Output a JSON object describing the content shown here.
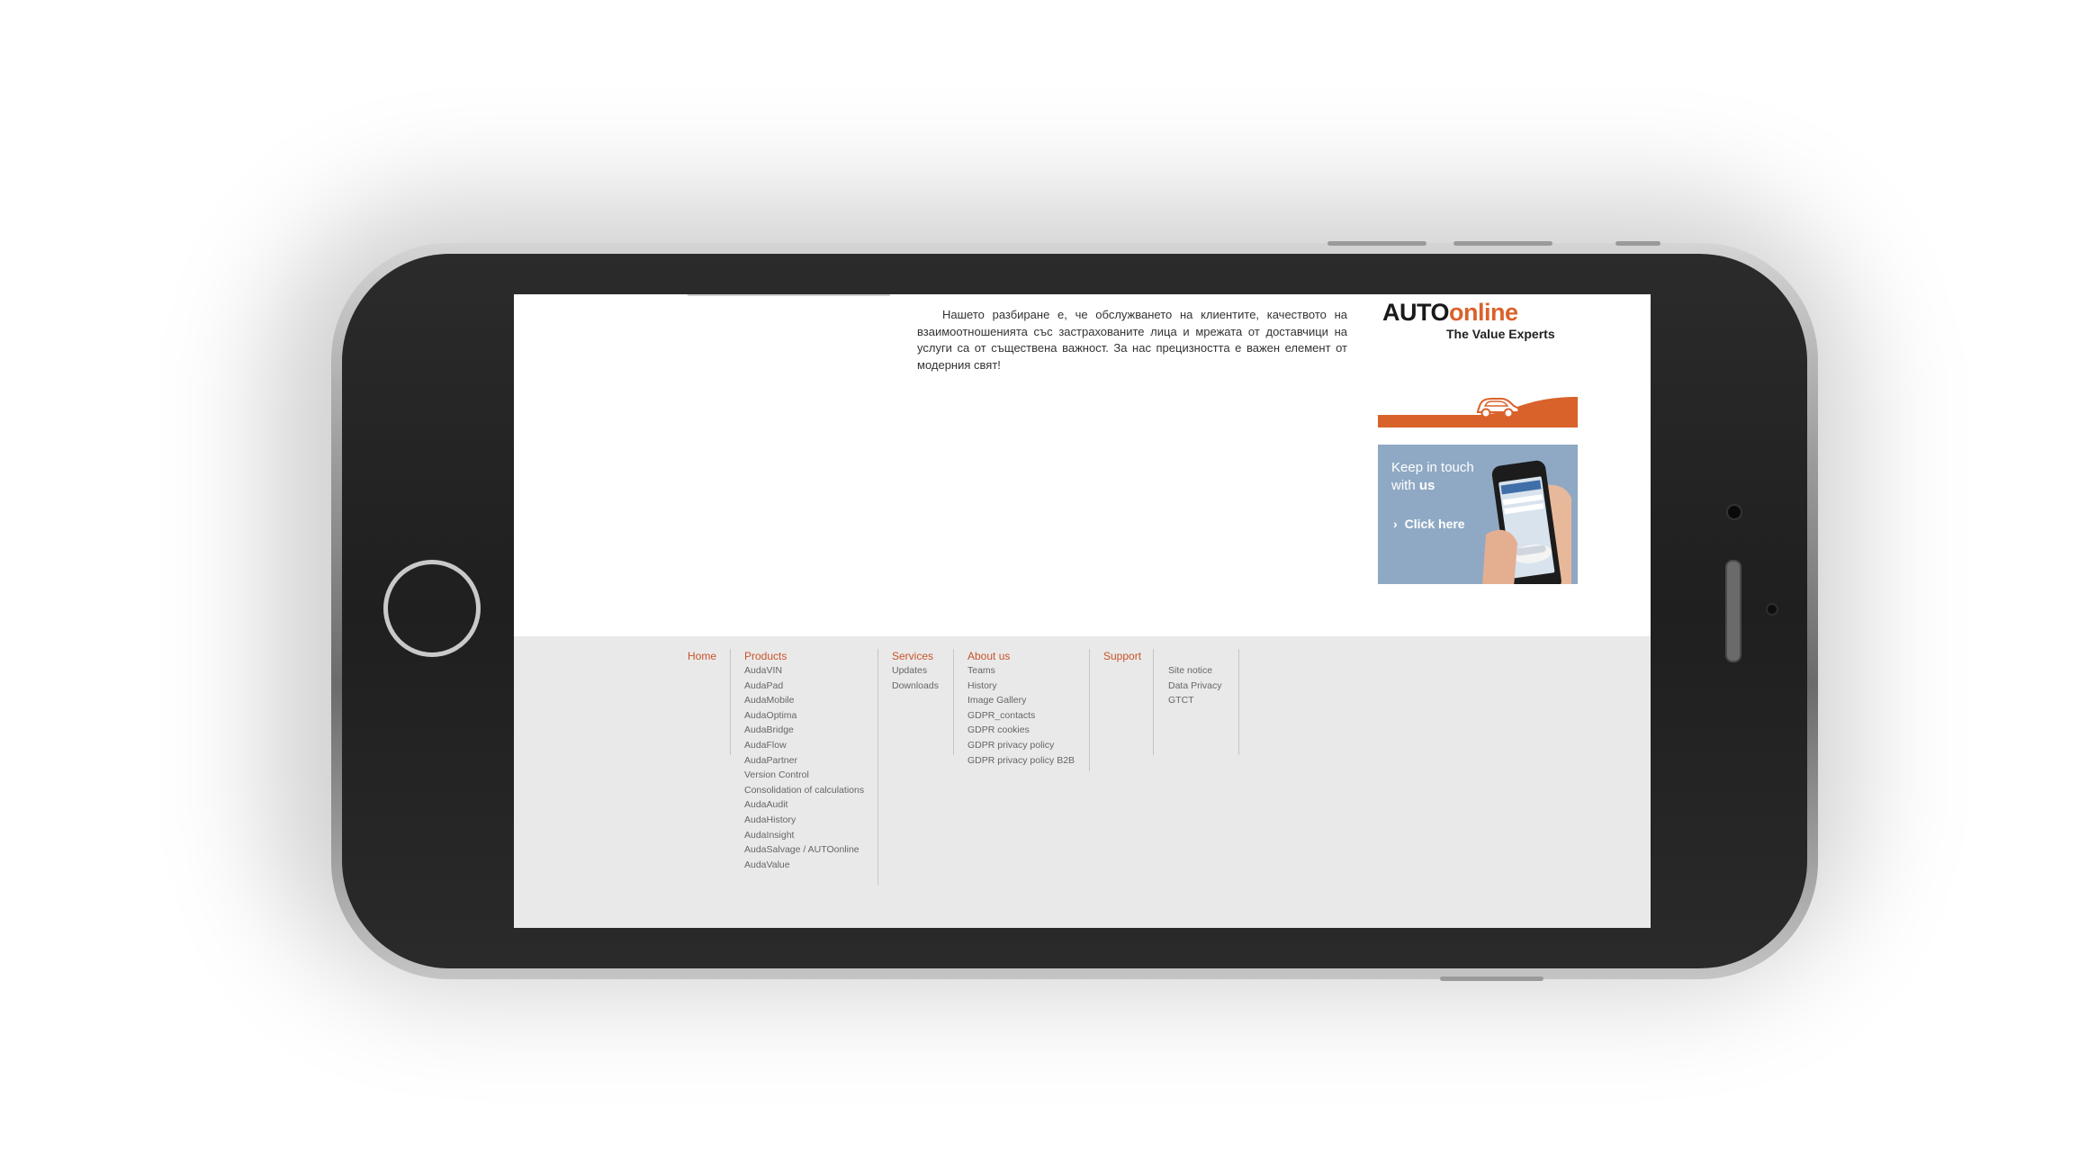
{
  "intro": {
    "text": "Нашето разбиране е, че обслужването на клиентите, качеството на взаимоотношенията със застрахованите лица и мрежата от доставчици на услуги са от съществена важност. За нас прецизността е важен елемент от модерния свят!"
  },
  "logo": {
    "part1": "AUTO",
    "part2": "online",
    "tagline": "The Value Experts"
  },
  "ad": {
    "title_line1": "Keep in touch",
    "title_line2_prefix": "with ",
    "title_line2_bold": "us",
    "cta_chevron": "›",
    "cta": "Click here"
  },
  "footer": {
    "home": "Home",
    "products": {
      "title": "Products",
      "items": [
        "AudaVIN",
        "AudaPad",
        "AudaMobile",
        "AudaOptima",
        "AudaBridge",
        "AudaFlow",
        "AudaPartner",
        "Version Control",
        "Consolidation of calculations",
        "AudaAudit",
        "AudaHistory",
        "AudaInsight",
        "AudaSalvage / AUTOonline",
        "AudaValue"
      ]
    },
    "services": {
      "title": "Services",
      "items": [
        "Updates",
        "Downloads"
      ]
    },
    "about": {
      "title": "About us",
      "items": [
        "Teams",
        "History",
        "Image Gallery",
        "GDPR_contacts",
        "GDPR cookies",
        "GDPR privacy policy",
        "GDPR privacy policy B2B"
      ]
    },
    "support": {
      "title": "Support"
    },
    "legal": {
      "items": [
        "Site notice",
        "Data Privacy",
        "GTCT"
      ]
    }
  },
  "colors": {
    "accent": "#d9622b",
    "footer_bg": "#e9e9e9",
    "ad_bg": "#8fa9c4"
  }
}
